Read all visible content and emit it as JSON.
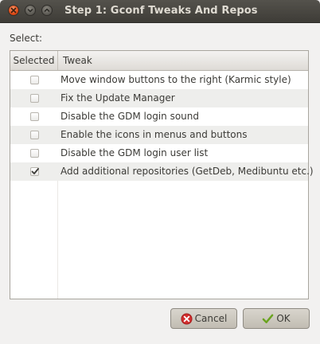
{
  "window": {
    "title": "Step 1: Gconf Tweaks And Repos"
  },
  "icons": {
    "close": "close-icon",
    "minimize": "minimize-icon",
    "maximize": "maximize-icon",
    "cancel": "cancel-icon",
    "ok": "checkmark-icon",
    "checkbox_checked": "checkmark-icon"
  },
  "colors": {
    "close_button": "#df4a16",
    "titlebar": "#4a4843",
    "ok_check": "#6aa31f",
    "cancel_icon": "#d22e2e"
  },
  "main": {
    "prompt": "Select:",
    "table": {
      "headers": [
        "Selected",
        "Tweak"
      ],
      "rows": [
        {
          "checked": false,
          "tweak": "Move window buttons to the right (Karmic style)"
        },
        {
          "checked": false,
          "tweak": "Fix the Update Manager"
        },
        {
          "checked": false,
          "tweak": "Disable the GDM login sound"
        },
        {
          "checked": false,
          "tweak": "Enable the icons in menus and buttons"
        },
        {
          "checked": false,
          "tweak": "Disable the GDM login user list"
        },
        {
          "checked": true,
          "tweak": "Add additional repositories (GetDeb, Medibuntu etc.)"
        }
      ]
    }
  },
  "buttons": {
    "cancel_label": "Cancel",
    "ok_label": "OK"
  }
}
